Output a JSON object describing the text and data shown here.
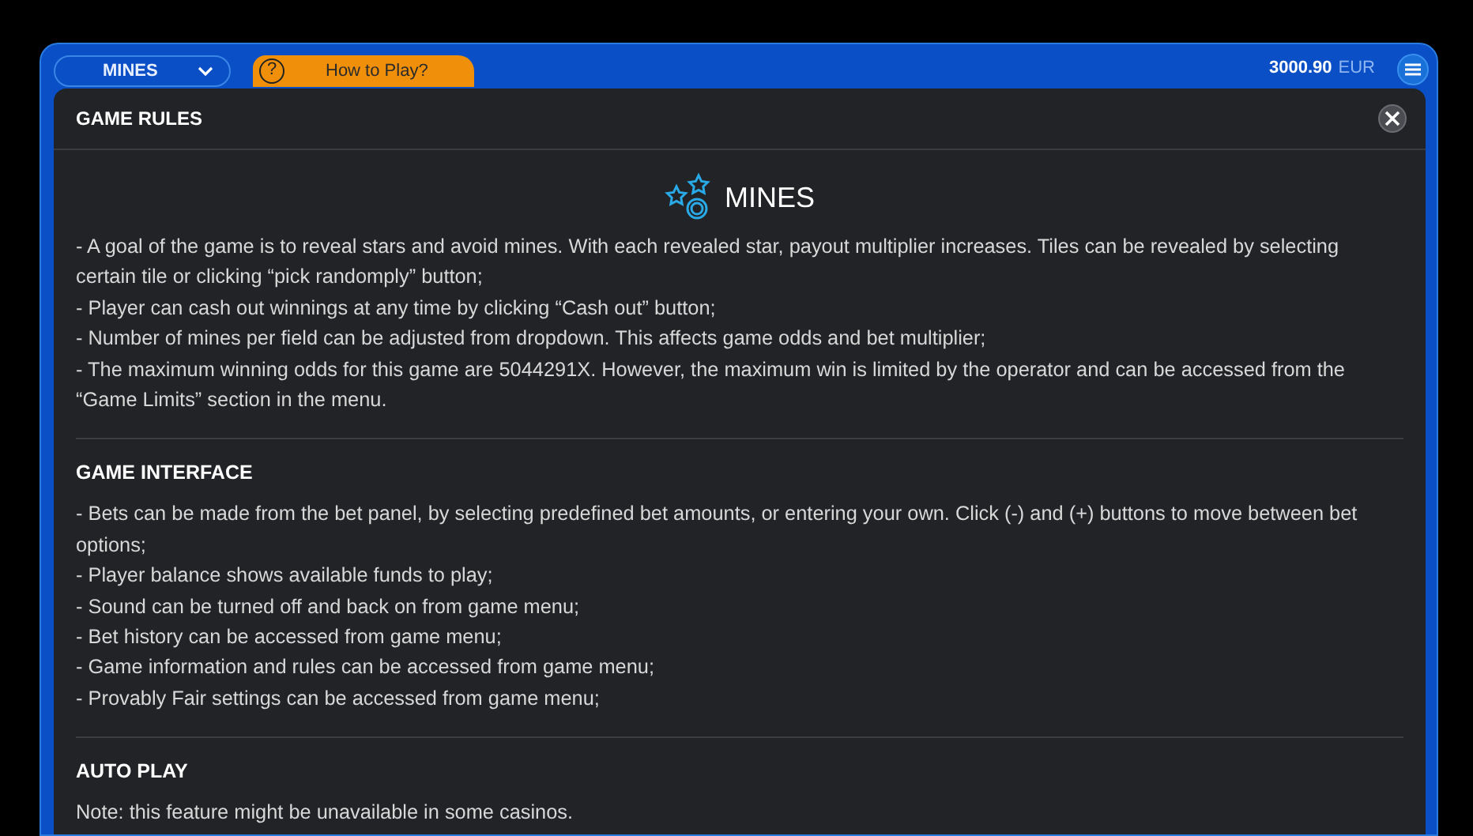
{
  "top_bar": {
    "game_select": "MINES",
    "help_glyph": "?",
    "help_button": "How to Play?",
    "balance": "3000.90",
    "currency": "EUR"
  },
  "modal": {
    "title": "GAME RULES",
    "game_name": "MINES",
    "intro": [
      "- A goal of the game is to reveal stars and avoid mines. With each revealed star, payout multiplier increases. Tiles can be revealed by selecting certain tile or clicking “pick randomply” button;",
      "- Player can cash out winnings at any time by clicking “Cash out” button;",
      "- Number of mines per field can be adjusted from dropdown. This affects game odds and bet multiplier;",
      "- The maximum winning odds for this game are 5044291X. However, the maximum win is limited by the operator and can be accessed from the “Game Limits” section in the menu."
    ],
    "sections": [
      {
        "heading": "GAME INTERFACE",
        "lines": [
          "- Bets can be made from the bet panel, by selecting predefined bet amounts, or entering your own. Click (-) and (+) buttons to move between bet options;",
          "- Player balance shows available funds to play;",
          "- Sound can be turned off and back on from game menu;",
          "- Bet history can be accessed from game menu;",
          "- Game information and rules can be accessed from game menu;",
          "- Provably Fair settings can be accessed from game menu;"
        ]
      },
      {
        "heading": "AUTO PLAY",
        "lines": [
          "Note: this feature might be unavailable in some casinos."
        ]
      }
    ]
  }
}
